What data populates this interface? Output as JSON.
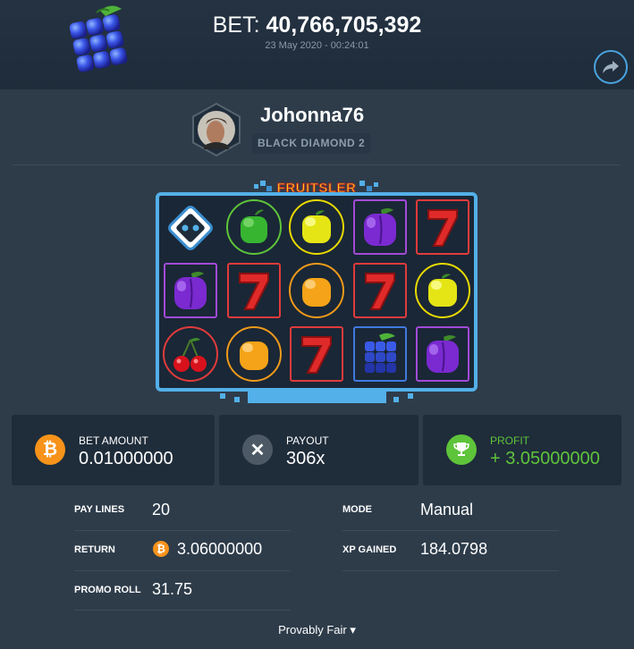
{
  "header": {
    "bet_label": "BET:",
    "bet_amount": "40,766,705,392",
    "date": "23 May 2020 - 00:24:01",
    "share_icon": "share-arrow-icon",
    "logo_icon": "blueberry-cube-logo"
  },
  "player": {
    "username": "Johonna76",
    "rank": "BLACK DIAMOND 2",
    "avatar_icon": "user-avatar"
  },
  "game": {
    "title": "FRUITSLER",
    "reels": [
      [
        "logo",
        "apple-green",
        "lemon-yellow",
        "plum-purple",
        "seven-red"
      ],
      [
        "plum-purple",
        "seven-red",
        "orange",
        "seven-red",
        "lemon-yellow"
      ],
      [
        "cherry",
        "orange",
        "seven-red",
        "blueberry",
        "plum-purple"
      ]
    ]
  },
  "stats": {
    "bet_amount_label": "BET AMOUNT",
    "bet_amount_value": "0.01000000",
    "payout_label": "PAYOUT",
    "payout_value": "306x",
    "profit_label": "PROFIT",
    "profit_value": "+ 3.05000000"
  },
  "details": {
    "pay_lines_label": "PAY LINES",
    "pay_lines_value": "20",
    "mode_label": "MODE",
    "mode_value": "Manual",
    "return_label": "RETURN",
    "return_value": "3.06000000",
    "xp_label": "XP GAINED",
    "xp_value": "184.0798",
    "promo_label": "PROMO ROLL",
    "promo_value": "31.75"
  },
  "footer": {
    "provably_fair": "Provably Fair",
    "caret": "▾"
  },
  "colors": {
    "profit_green": "#5ec43a",
    "bitcoin_orange": "#f7931a",
    "payout_gray": "#4d5a66",
    "frame_blue": "#53b0e8"
  }
}
